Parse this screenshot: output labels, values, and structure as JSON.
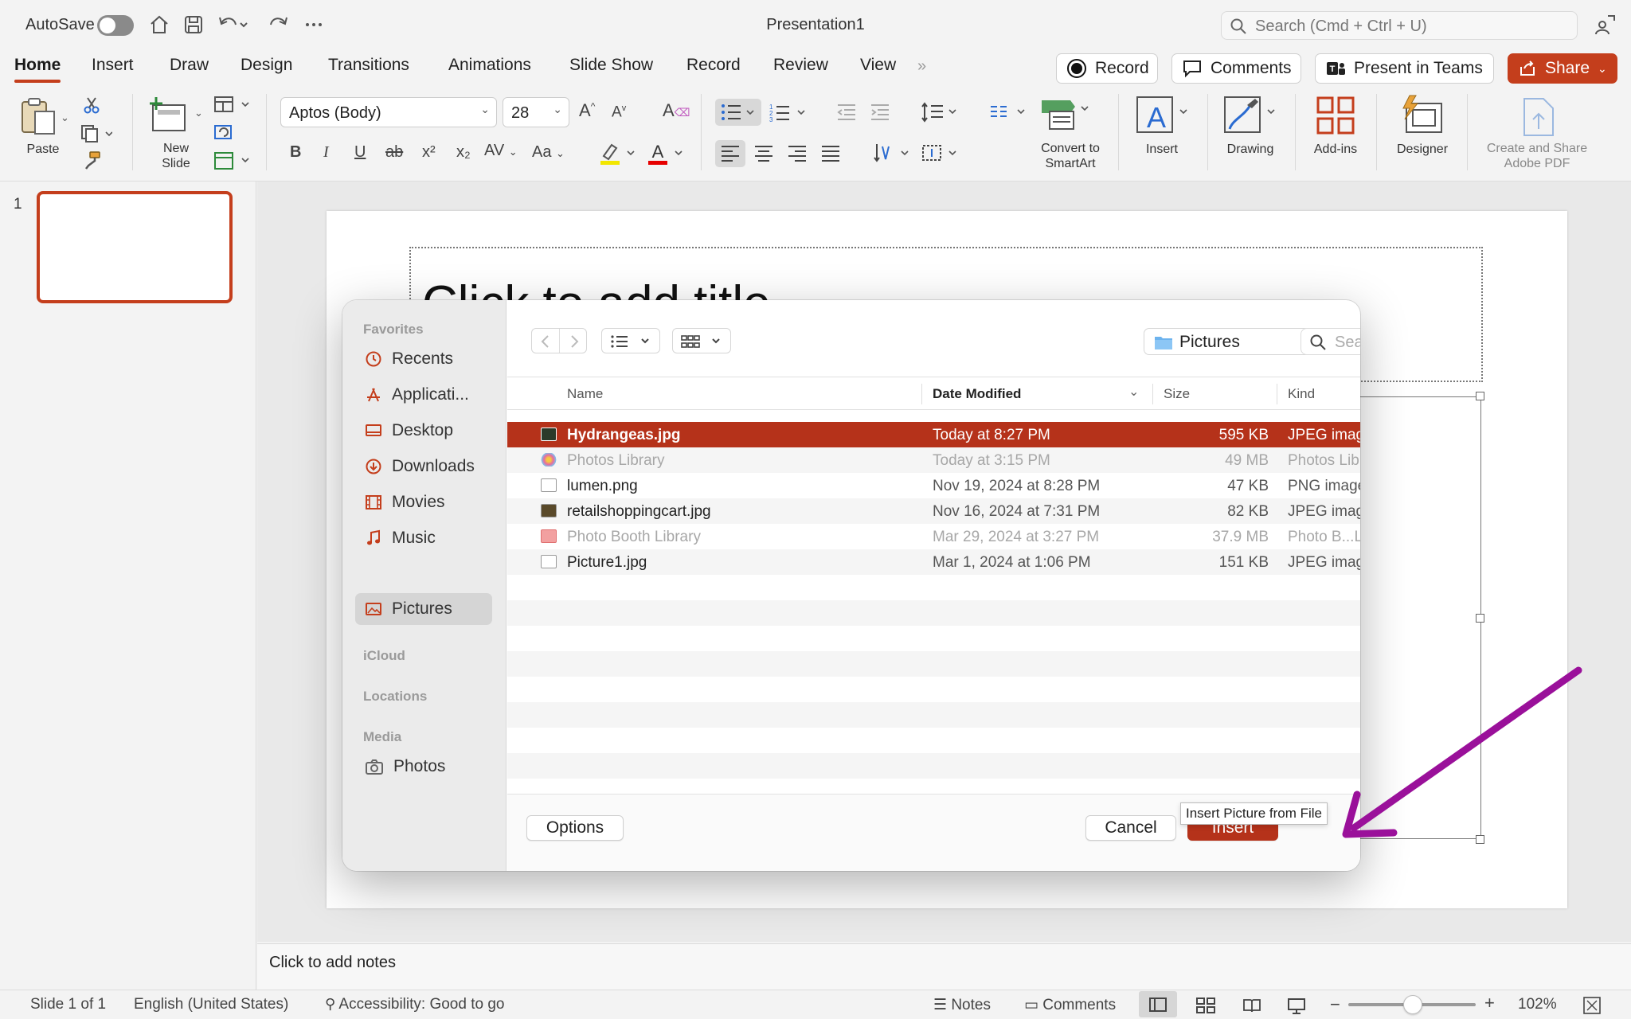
{
  "titlebar": {
    "autosave_label": "AutoSave",
    "doc_title": "Presentation1",
    "search_placeholder": "Search (Cmd + Ctrl + U)"
  },
  "tabs": [
    "Home",
    "Insert",
    "Draw",
    "Design",
    "Transitions",
    "Animations",
    "Slide Show",
    "Record",
    "Review",
    "View"
  ],
  "top_buttons": {
    "record": "Record",
    "comments": "Comments",
    "present": "Present in Teams",
    "share": "Share"
  },
  "ribbon": {
    "paste": "Paste",
    "new_slide_line1": "New",
    "new_slide_line2": "Slide",
    "font_name": "Aptos (Body)",
    "font_size": "28",
    "bold": "B",
    "italic": "I",
    "underline": "U",
    "strike": "ab",
    "superscript": "x²",
    "subscript": "x₂",
    "char_spacing": "AV",
    "change_case": "Aa",
    "convert_line1": "Convert to",
    "convert_line2": "SmartArt",
    "insert": "Insert",
    "drawing": "Drawing",
    "addins": "Add-ins",
    "designer": "Designer",
    "adobe_line1": "Create and Share",
    "adobe_line2": "Adobe PDF"
  },
  "slides_pane": {
    "slide_number": "1"
  },
  "slide": {
    "title_placeholder": "Click to add title"
  },
  "notes": {
    "placeholder": "Click to add notes"
  },
  "status": {
    "slide_of": "Slide 1 of 1",
    "language": "English (United States)",
    "accessibility": "Accessibility: Good to go",
    "notes": "Notes",
    "comments": "Comments",
    "zoom": "102%"
  },
  "dialog": {
    "sidebar": {
      "favorites_header": "Favorites",
      "favorites": [
        "Recents",
        "Applicati...",
        "Desktop",
        "Downloads",
        "Movies",
        "Music"
      ],
      "selected": "Pictures",
      "icloud_header": "iCloud",
      "locations_header": "Locations",
      "media_header": "Media",
      "media": [
        "Photos"
      ]
    },
    "location": "Pictures",
    "search_placeholder": "Search",
    "columns": {
      "name": "Name",
      "date": "Date Modified",
      "size": "Size",
      "kind": "Kind"
    },
    "files": [
      {
        "name": "Hydrangeas.jpg",
        "date": "Today at 8:27 PM",
        "size": "595 KB",
        "kind": "JPEG imag"
      },
      {
        "name": "Photos Library",
        "date": "Today at 3:15 PM",
        "size": "49 MB",
        "kind": "Photos Lib"
      },
      {
        "name": "lumen.png",
        "date": "Nov 19, 2024 at 8:28 PM",
        "size": "47 KB",
        "kind": "PNG image"
      },
      {
        "name": "retailshoppingcart.jpg",
        "date": "Nov 16, 2024 at 7:31 PM",
        "size": "82 KB",
        "kind": "JPEG imag"
      },
      {
        "name": "Photo Booth Library",
        "date": "Mar 29, 2024 at 3:27 PM",
        "size": "37.9 MB",
        "kind": "Photo B...L"
      },
      {
        "name": "Picture1.jpg",
        "date": "Mar 1, 2024 at 1:06 PM",
        "size": "151 KB",
        "kind": "JPEG imag"
      }
    ],
    "options": "Options",
    "cancel": "Cancel",
    "insert": "Insert",
    "tooltip": "Insert Picture from File"
  },
  "colors": {
    "accent": "#c43e1c",
    "selection": "#b5321a",
    "arrow": "#9a109a"
  }
}
